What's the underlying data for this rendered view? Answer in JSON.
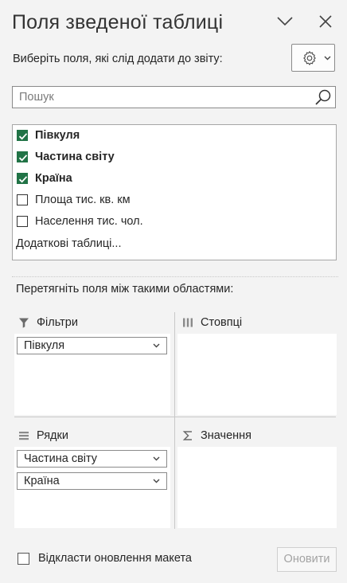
{
  "header": {
    "title": "Поля зведеної таблиці",
    "collapse_icon": "chevron-down-icon",
    "close_icon": "close-icon"
  },
  "subtitle": "Виберіть поля, які слід додати до звіту:",
  "tools_icon": "gear-icon",
  "search": {
    "placeholder": "Пошук",
    "value": ""
  },
  "fields": [
    {
      "label": "Півкуля",
      "checked": true
    },
    {
      "label": "Частина світу",
      "checked": true
    },
    {
      "label": "Країна",
      "checked": true
    },
    {
      "label": "Площа тис. кв. км",
      "checked": false
    },
    {
      "label": "Населення тис. чол.",
      "checked": false
    }
  ],
  "more_tables": "Додаткові таблиці...",
  "drag_hint": "Перетягніть поля між такими областями:",
  "areas": {
    "filters": {
      "label": "Фільтри",
      "icon": "filter-icon",
      "items": [
        "Півкуля"
      ]
    },
    "columns": {
      "label": "Стовпці",
      "icon": "columns-icon",
      "items": []
    },
    "rows": {
      "label": "Рядки",
      "icon": "rows-icon",
      "items": [
        "Частина світу",
        "Країна"
      ]
    },
    "values": {
      "label": "Значення",
      "icon": "sigma-icon",
      "items": []
    }
  },
  "footer": {
    "defer_label": "Відкласти оновлення макета",
    "defer_checked": false,
    "update_label": "Оновити"
  },
  "colors": {
    "accent": "#217346",
    "panel_bg": "#f3f3f3"
  }
}
